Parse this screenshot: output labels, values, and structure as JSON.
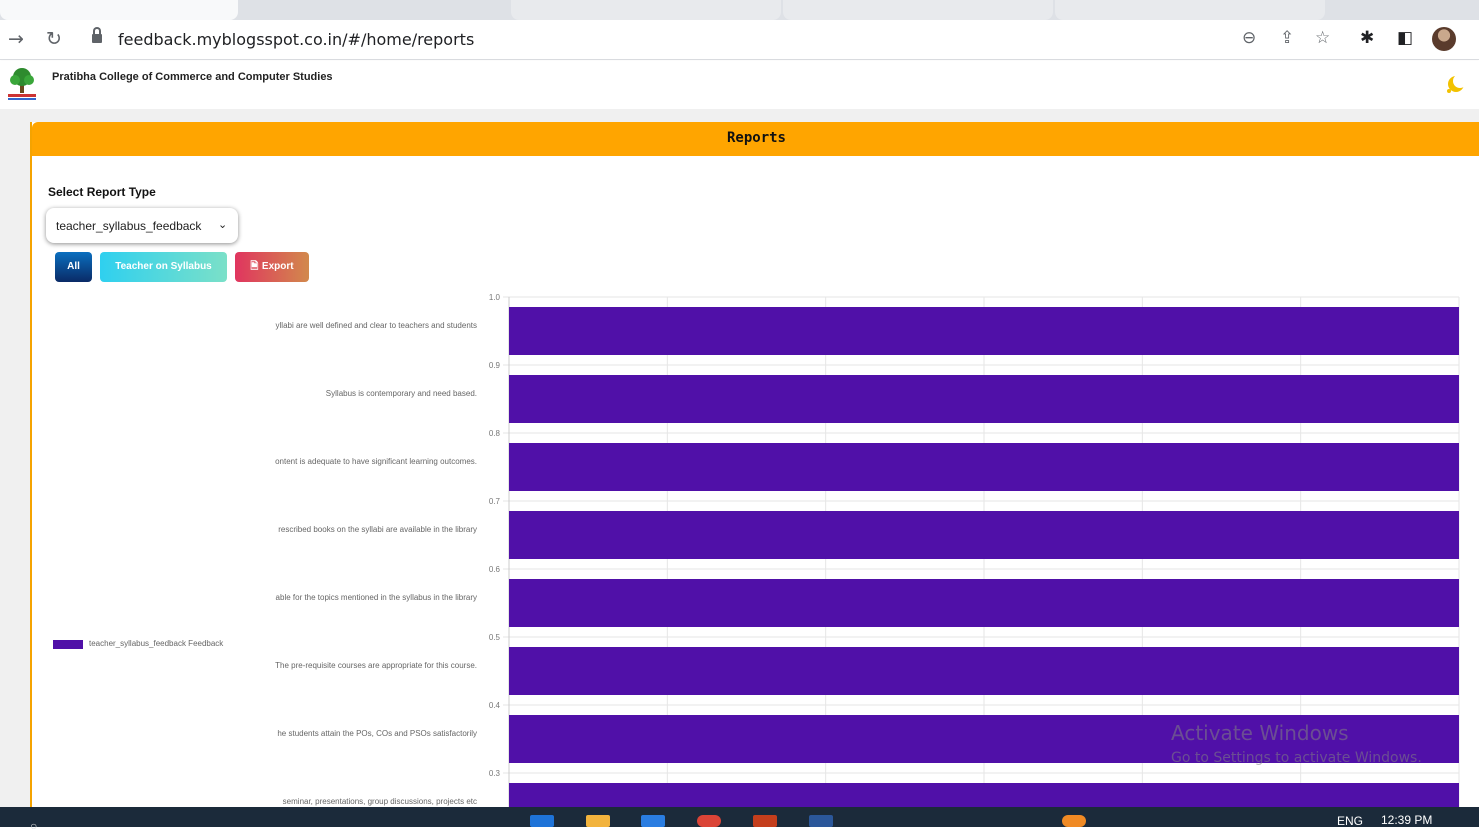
{
  "browser": {
    "url": "feedback.myblogsspot.co.in/#/home/reports",
    "back_icon": "arrow-right-icon",
    "reload_icon": "reload-icon",
    "toolbar_icons": [
      "zoom-icon",
      "share-icon",
      "star-icon",
      "extensions-icon",
      "sidepanel-icon",
      "profile-avatar"
    ]
  },
  "site": {
    "college_name": "Pratibha College of Commerce and Computer Studies"
  },
  "reports": {
    "header_title": "Reports",
    "select_label": "Select Report Type",
    "select_value": "teacher_syllabus_feedback",
    "buttons": {
      "all": "All",
      "teacher": "Teacher on Syllabus",
      "export": "Export"
    },
    "colors": {
      "header": "#ffa500",
      "bar": "#5010a8"
    }
  },
  "chart_data": {
    "type": "bar",
    "orientation": "horizontal",
    "categories": [
      "yllabi are well defined and clear to teachers and students",
      "Syllabus is contemporary and need based.",
      "ontent is adequate to have significant learning outcomes.",
      "rescribed books on the syllabi are available in the library",
      "able for the topics mentioned in the syllabus in the library",
      "The pre-requisite courses are appropriate for this course.",
      "he students attain the POs, COs and PSOs satisfactorily",
      "seminar, presentations, group discussions, projects etc"
    ],
    "series": [
      {
        "name": "teacher_syllabus_feedback Feedback",
        "values": [
          1,
          1,
          1,
          1,
          1,
          1,
          1,
          1
        ]
      }
    ],
    "axis_tick_labels": [
      "1.0",
      "0.9",
      "0.8",
      "0.7",
      "0.6",
      "0.5",
      "0.4",
      "0.3"
    ],
    "legend": "left",
    "grid": true
  },
  "overlay": {
    "activate_title": "Activate Windows",
    "activate_sub": "Go to Settings to activate Windows."
  },
  "taskbar": {
    "lang": "ENG",
    "time": "12:39 PM"
  }
}
